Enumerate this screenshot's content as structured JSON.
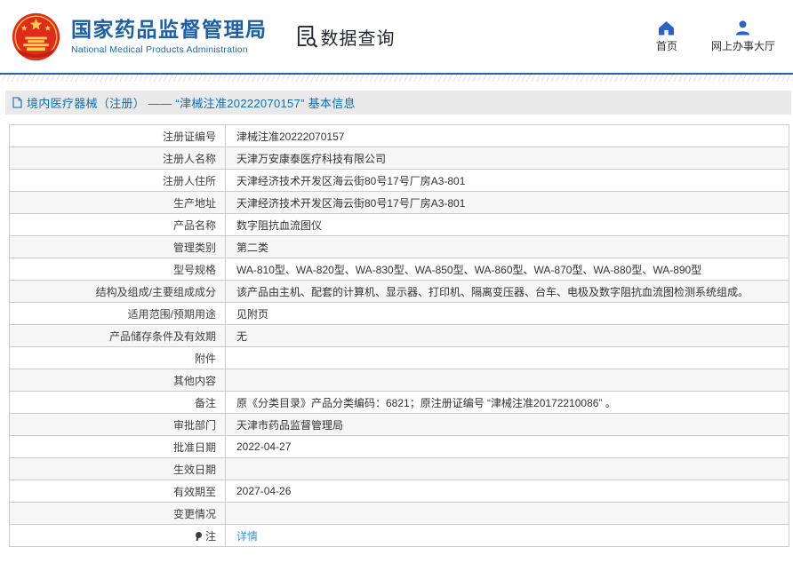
{
  "header": {
    "brand": {
      "title_zh": "国家药品监督管理局",
      "title_en": "National Medical Products Administration"
    },
    "data_query_label": "数据查询",
    "nav": [
      {
        "label": "首页",
        "icon": "home-icon"
      },
      {
        "label": "网上办事大厅",
        "icon": "person-icon"
      }
    ]
  },
  "page_title": "境内医疗器械（注册） —— “津械注准20222070157” 基本信息",
  "table": {
    "rows": [
      {
        "label": "注册证编号",
        "value": "津械注准20222070157"
      },
      {
        "label": "注册人名称",
        "value": "天津万安康泰医疗科技有限公司"
      },
      {
        "label": "注册人住所",
        "value": "天津经济技术开发区海云街80号17号厂房A3-801"
      },
      {
        "label": "生产地址",
        "value": "天津经济技术开发区海云街80号17号厂房A3-801"
      },
      {
        "label": "产品名称",
        "value": "数字阻抗血流图仪"
      },
      {
        "label": "管理类别",
        "value": "第二类"
      },
      {
        "label": "型号规格",
        "value": "WA-810型、WA-820型、WA-830型、WA-850型、WA-860型、WA-870型、WA-880型、WA-890型"
      },
      {
        "label": "结构及组成/主要组成成分",
        "value": "该产品由主机、配套的计算机、显示器、打印机、隔离变压器、台车、电极及数字阻抗血流图检测系统组成。"
      },
      {
        "label": "适用范围/预期用途",
        "value": "见附页"
      },
      {
        "label": "产品储存条件及有效期",
        "value": "无"
      },
      {
        "label": "附件",
        "value": ""
      },
      {
        "label": "其他内容",
        "value": ""
      },
      {
        "label": "备注",
        "value": "原《分类目录》产品分类编码：6821；原注册证编号 “津械注准20172210086” 。"
      },
      {
        "label": "审批部门",
        "value": "天津市药品监督管理局"
      },
      {
        "label": "批准日期",
        "value": "2022-04-27"
      },
      {
        "label": "生效日期",
        "value": ""
      },
      {
        "label": "有效期至",
        "value": "2027-04-26"
      },
      {
        "label": "变更情况",
        "value": ""
      },
      {
        "label": "注",
        "value": "详情",
        "label_icon": "pin-icon",
        "value_is_link": true
      }
    ]
  },
  "colors": {
    "brand_blue": "#1b5fa9",
    "header_divider": "#1f66ad",
    "title_text": "#0f6fb5",
    "title_bar_bg": "#e9e9e9",
    "table_border": "#cbcbcb",
    "zebra_row": "#f6f6f6",
    "link": "#3f8fd2",
    "emblem_red": "#de2b1c",
    "emblem_gold": "#ffd24a"
  }
}
